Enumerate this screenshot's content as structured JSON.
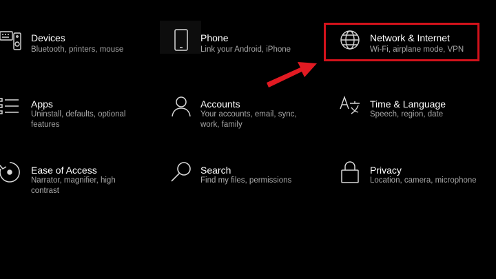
{
  "accent_color": "#d3121b",
  "tiles": [
    {
      "title": "Devices",
      "desc": "Bluetooth, printers, mouse",
      "icon": "keyboard-speaker-icon"
    },
    {
      "title": "Phone",
      "desc": "Link your Android, iPhone",
      "icon": "phone-icon"
    },
    {
      "title": "Network & Internet",
      "desc": "Wi-Fi, airplane mode, VPN",
      "icon": "globe-icon"
    },
    {
      "title": "Apps",
      "desc": "Uninstall, defaults, optional features",
      "icon": "apps-list-icon"
    },
    {
      "title": "Accounts",
      "desc": "Your accounts, email, sync, work, family",
      "icon": "person-icon"
    },
    {
      "title": "Time & Language",
      "desc": "Speech, region, date",
      "icon": "time-language-icon"
    },
    {
      "title": "Ease of Access",
      "desc": "Narrator, magnifier, high contrast",
      "icon": "ease-of-access-icon"
    },
    {
      "title": "Search",
      "desc": "Find my files, permissions",
      "icon": "search-icon"
    },
    {
      "title": "Privacy",
      "desc": "Location, camera, microphone",
      "icon": "lock-icon"
    }
  ]
}
